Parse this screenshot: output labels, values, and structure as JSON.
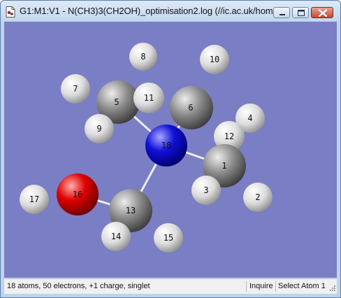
{
  "window": {
    "title": "G1:M1:V1 - N(CH3)3(CH2OH)_optimisation2.log (//ic.ac.uk/hom...",
    "controls": [
      "minimize",
      "maximize",
      "close"
    ]
  },
  "molecule": {
    "bonds": [
      [
        "5",
        "18"
      ],
      [
        "6",
        "18"
      ],
      [
        "1",
        "18"
      ],
      [
        "13",
        "18"
      ],
      [
        "13",
        "16"
      ]
    ],
    "atoms": [
      {
        "label": "7"
      },
      {
        "label": "8"
      },
      {
        "label": "10"
      },
      {
        "label": "5"
      },
      {
        "label": "11"
      },
      {
        "label": "6"
      },
      {
        "label": "9"
      },
      {
        "label": "4"
      },
      {
        "label": "12"
      },
      {
        "label": "18"
      },
      {
        "label": "1"
      },
      {
        "label": "3"
      },
      {
        "label": "2"
      },
      {
        "label": "17"
      },
      {
        "label": "16"
      },
      {
        "label": "13"
      },
      {
        "label": "14"
      },
      {
        "label": "15"
      }
    ]
  },
  "colors": {
    "background": "#7a7ec4",
    "hydrogen": "#e6e6e6",
    "carbon": "#8a8a8a",
    "nitrogen": "#1010d8",
    "oxygen": "#e00000"
  },
  "status": {
    "info": "18 atoms, 50 electrons, +1 charge, singlet",
    "mode": "Inquire",
    "selection": "Select Atom 1"
  }
}
